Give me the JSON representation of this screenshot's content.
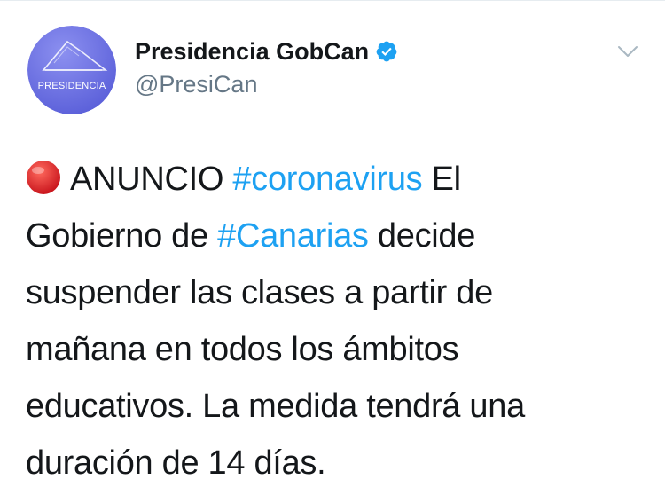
{
  "author": {
    "display_name": "Presidencia GobCan",
    "handle": "@PresiCan",
    "avatar_label": "PRESIDENCIA",
    "verified": true
  },
  "icons": {
    "verified": "verified-badge-icon",
    "menu": "chevron-down-icon",
    "emoji": "red-circle-emoji-icon"
  },
  "tweet": {
    "line1_text1": "ANUNCIO",
    "line1_hashtag": "#coronavirus",
    "line1_text2": "El",
    "line2_text1": "Gobierno de",
    "line2_hashtag": "#Canarias",
    "line2_text2": "decide",
    "line3": "suspender las clases a partir de",
    "line4": "mañana en todos los ámbitos",
    "line5": "educativos. La medida tendrá una",
    "line6": "duración de 14 días."
  },
  "colors": {
    "hashtag": "#1da1f2",
    "verified": "#1da1f2",
    "text": "#14171a",
    "secondary": "#657786",
    "avatar": "#6f74e8",
    "emoji_red": "#e0262b"
  }
}
